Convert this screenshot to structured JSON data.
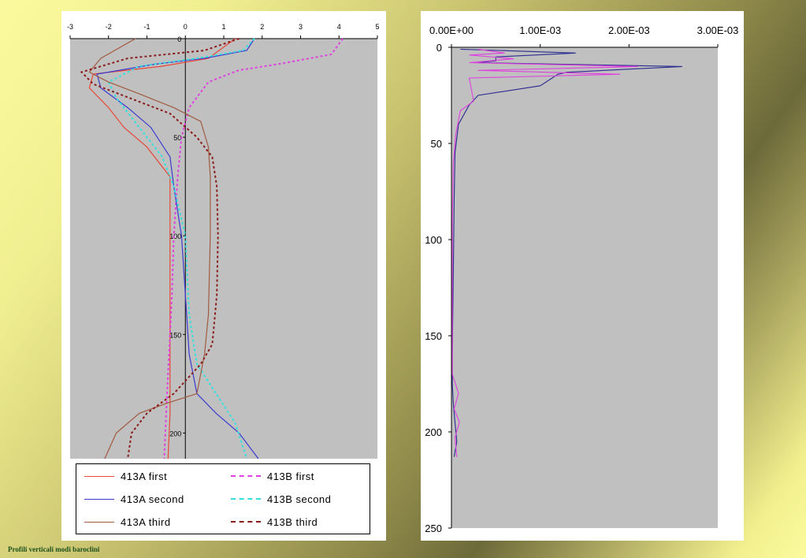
{
  "footer": {
    "caption": "Profili verticali modi baroclini"
  },
  "chart_data": [
    {
      "type": "line",
      "x_ticks": [
        "-3",
        "-2",
        "-1",
        "0",
        "1",
        "2",
        "3",
        "4",
        "5"
      ],
      "xlim": [
        -3,
        5
      ],
      "y_ticks": [
        "0",
        "50",
        "100",
        "150",
        "200"
      ],
      "ylim": [
        0,
        213
      ],
      "y_inverted": true,
      "legend_placement": "bottom",
      "series": [
        {
          "name": "413A first",
          "color": "#e8473a",
          "dash": false,
          "x": [
            1.3,
            0.6,
            -0.6,
            -2.4,
            -2.5,
            -2.0,
            -1.6,
            -1.0,
            -0.4,
            -0.4,
            -0.4,
            -0.4,
            -0.4,
            -0.4,
            -0.45
          ],
          "y": [
            0,
            10,
            14,
            18,
            25,
            35,
            45,
            55,
            70,
            100,
            130,
            150,
            170,
            190,
            213
          ]
        },
        {
          "name": "413B first",
          "color": "#e040e0",
          "dash": true,
          "x": [
            4.1,
            3.8,
            2.4,
            1.4,
            0.6,
            0.1,
            -0.1,
            -0.2,
            -0.3,
            -0.35,
            -0.4,
            -0.45,
            -0.5,
            -0.55
          ],
          "y": [
            0,
            8,
            13,
            16,
            22,
            35,
            50,
            70,
            100,
            130,
            150,
            170,
            190,
            213
          ]
        },
        {
          "name": "413A second",
          "color": "#3a3ad0",
          "dash": false,
          "x": [
            1.8,
            1.6,
            0.5,
            -0.8,
            -2.3,
            -2.2,
            -1.5,
            -0.9,
            -0.4,
            -0.3,
            -0.1,
            0.0,
            0.1,
            0.3,
            0.8,
            1.4,
            1.9
          ],
          "y": [
            0,
            6,
            10,
            13,
            18,
            25,
            35,
            45,
            60,
            75,
            100,
            130,
            160,
            180,
            190,
            200,
            213
          ]
        },
        {
          "name": "413B second",
          "color": "#33e0e0",
          "dash": true,
          "x": [
            1.8,
            1.5,
            0.3,
            -1.2,
            -2.0,
            -1.8,
            -1.2,
            -0.6,
            -0.3,
            0.0,
            0.1,
            0.3,
            0.8,
            1.3,
            1.6
          ],
          "y": [
            0,
            6,
            10,
            14,
            22,
            30,
            45,
            60,
            75,
            100,
            140,
            165,
            180,
            195,
            213
          ]
        },
        {
          "name": "413A third",
          "color": "#a05a40",
          "dash": false,
          "x": [
            -1.3,
            -2.2,
            -2.5,
            -2.0,
            -1.2,
            -0.3,
            0.4,
            0.6,
            0.65,
            0.65,
            0.6,
            0.5,
            0.3,
            -0.5,
            -1.2,
            -1.8,
            -2.1
          ],
          "y": [
            0,
            10,
            17,
            22,
            28,
            35,
            42,
            55,
            70,
            100,
            140,
            160,
            180,
            185,
            190,
            200,
            213
          ]
        },
        {
          "name": "413B third",
          "color": "#8b1a1a",
          "dash": true,
          "x": [
            1.4,
            0.5,
            -1.5,
            -2.7,
            -2.4,
            -1.6,
            -0.4,
            0.3,
            0.7,
            0.82,
            0.85,
            0.82,
            0.7,
            0.4,
            -0.3,
            -1.0,
            -1.4,
            -1.5
          ],
          "y": [
            0,
            6,
            10,
            17,
            23,
            29,
            38,
            50,
            60,
            75,
            100,
            130,
            155,
            165,
            180,
            190,
            200,
            213
          ]
        }
      ]
    },
    {
      "type": "line",
      "x_ticks": [
        "0.00E+00",
        "1.00E-03",
        "2.00E-03",
        "3.00E-03"
      ],
      "xlim": [
        0,
        0.003
      ],
      "y_ticks": [
        "0",
        "50",
        "100",
        "150",
        "200",
        "250"
      ],
      "ylim": [
        0,
        250
      ],
      "y_inverted": true,
      "series": [
        {
          "color": "#2a2a90",
          "x": [
            0.0001,
            0.0014,
            0.0005,
            0.0005,
            0.0003,
            0.0026,
            0.0013,
            0.0012,
            0.001,
            0.0003,
            0.0002,
            8e-05,
            4e-05,
            3e-05,
            2e-05,
            1e-05,
            1e-05,
            2e-05,
            4e-05,
            6e-05,
            3e-05
          ],
          "y": [
            1,
            3,
            5,
            7,
            8,
            10,
            13,
            14,
            20,
            25,
            30,
            40,
            55,
            80,
            120,
            160,
            175,
            185,
            195,
            205,
            213
          ]
        },
        {
          "color": "#e040e0",
          "x": [
            0.0003,
            0.0006,
            0.0002,
            0.0007,
            0.0002,
            0.0021,
            0.0003,
            0.0019,
            0.0002,
            0.00025,
            0.0001,
            5e-05,
            2e-05,
            1e-05,
            1e-05,
            1e-05,
            8e-05,
            3e-05,
            9e-05,
            4e-05,
            6e-05
          ],
          "y": [
            1,
            3,
            4,
            6,
            8,
            10,
            12,
            14,
            16,
            28,
            33,
            45,
            60,
            90,
            130,
            170,
            180,
            188,
            195,
            203,
            213
          ]
        }
      ]
    }
  ]
}
